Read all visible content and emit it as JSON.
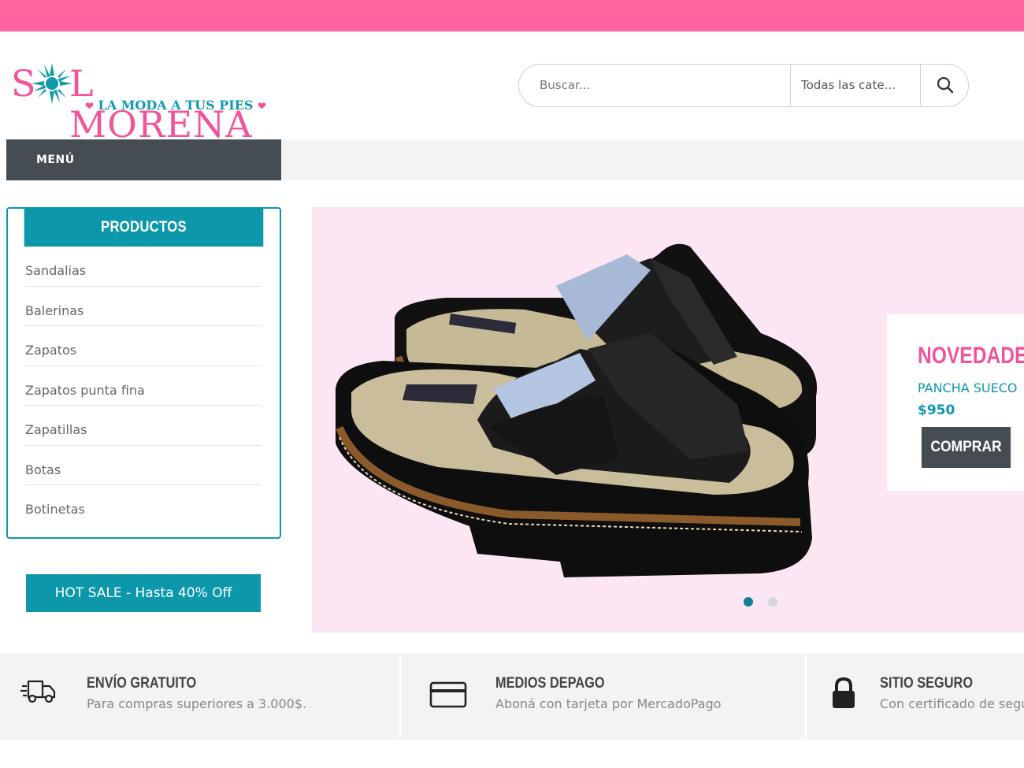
{
  "brand": {
    "name_first": "S",
    "name_rest": "L MORENA",
    "tagline": "LA MODA A TUS PIES",
    "colors": {
      "pink": "#f0549a",
      "teal": "#0d97ab",
      "dark": "#454d53",
      "top_bar": "#ff649e"
    }
  },
  "search": {
    "placeholder": "Buscar...",
    "category": "Todas las cate...",
    "button_icon": "search-icon"
  },
  "nav": {
    "menu_label": "MENÚ"
  },
  "products": {
    "title": "PRODUCTOS",
    "items": [
      "Sandalias",
      "Balerinas",
      "Zapatos",
      "Zapatos punta fina",
      "Zapatillas",
      "Botas",
      "Botinetas"
    ]
  },
  "promo": {
    "hot_sale": "HOT SALE - Hasta 40% Off"
  },
  "hero": {
    "kicker": "NOVEDADES",
    "product": "PANCHA SUECO",
    "price": "$950",
    "cta": "COMPRAR",
    "slides": 2,
    "active_slide": 1
  },
  "features": [
    {
      "icon": "truck-icon",
      "title": "ENVÍO GRATUITO",
      "desc": "Para compras superiores a 3.000$."
    },
    {
      "icon": "credit-card-icon",
      "title": "MEDIOS DEPAGO",
      "desc": "Aboná con tarjeta por MercadoPago"
    },
    {
      "icon": "lock-icon",
      "title": "SITIO SEGURO",
      "desc": "Con certificado de seguridad"
    }
  ]
}
